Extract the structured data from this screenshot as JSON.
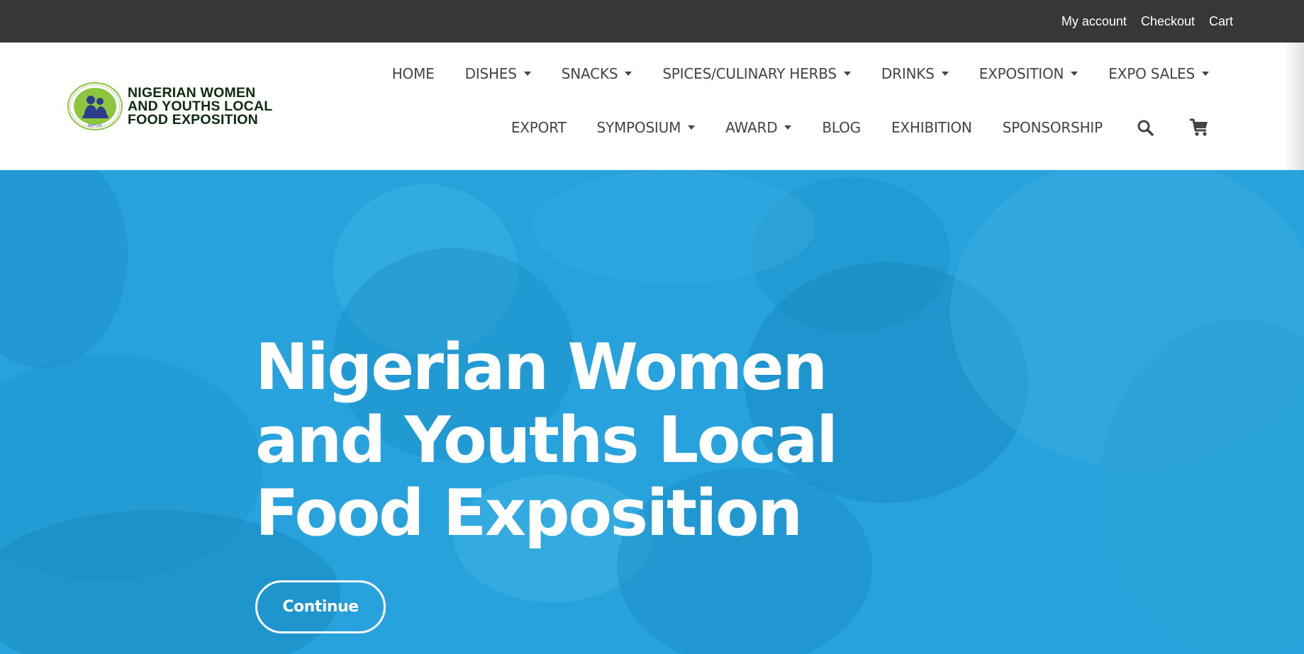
{
  "topbar": {
    "links": [
      "My account",
      "Checkout",
      "Cart"
    ]
  },
  "logo": {
    "lines": [
      "NIGERIAN WOMEN",
      "AND YOUTHS LOCAL",
      "FOOD EXPOSITION"
    ]
  },
  "nav": {
    "row1": [
      {
        "label": "HOME",
        "dropdown": false
      },
      {
        "label": "DISHES",
        "dropdown": true
      },
      {
        "label": "SNACKS",
        "dropdown": true
      },
      {
        "label": "SPICES/CULINARY HERBS",
        "dropdown": true
      },
      {
        "label": "DRINKS",
        "dropdown": true
      },
      {
        "label": "EXPOSITION",
        "dropdown": true
      },
      {
        "label": "EXPO SALES",
        "dropdown": true
      }
    ],
    "row2": [
      {
        "label": "EXPORT",
        "dropdown": false
      },
      {
        "label": "SYMPOSIUM",
        "dropdown": true
      },
      {
        "label": "AWARD",
        "dropdown": true
      },
      {
        "label": "BLOG",
        "dropdown": false
      },
      {
        "label": "EXHIBITION",
        "dropdown": false
      },
      {
        "label": "SPONSORSHIP",
        "dropdown": false
      }
    ],
    "icons": [
      "search-icon",
      "cart-icon"
    ]
  },
  "hero": {
    "title": "Nigerian Women and Youths Local Food Exposition",
    "button_label": "Continue",
    "overlay_color": "#27a2dc"
  },
  "colors": {
    "topbar": "#373737",
    "nav_text": "#444444",
    "logo_text": "#0d2b0d",
    "logo_circle": "#8cc63f",
    "logo_figures": "#2e3a8c"
  }
}
